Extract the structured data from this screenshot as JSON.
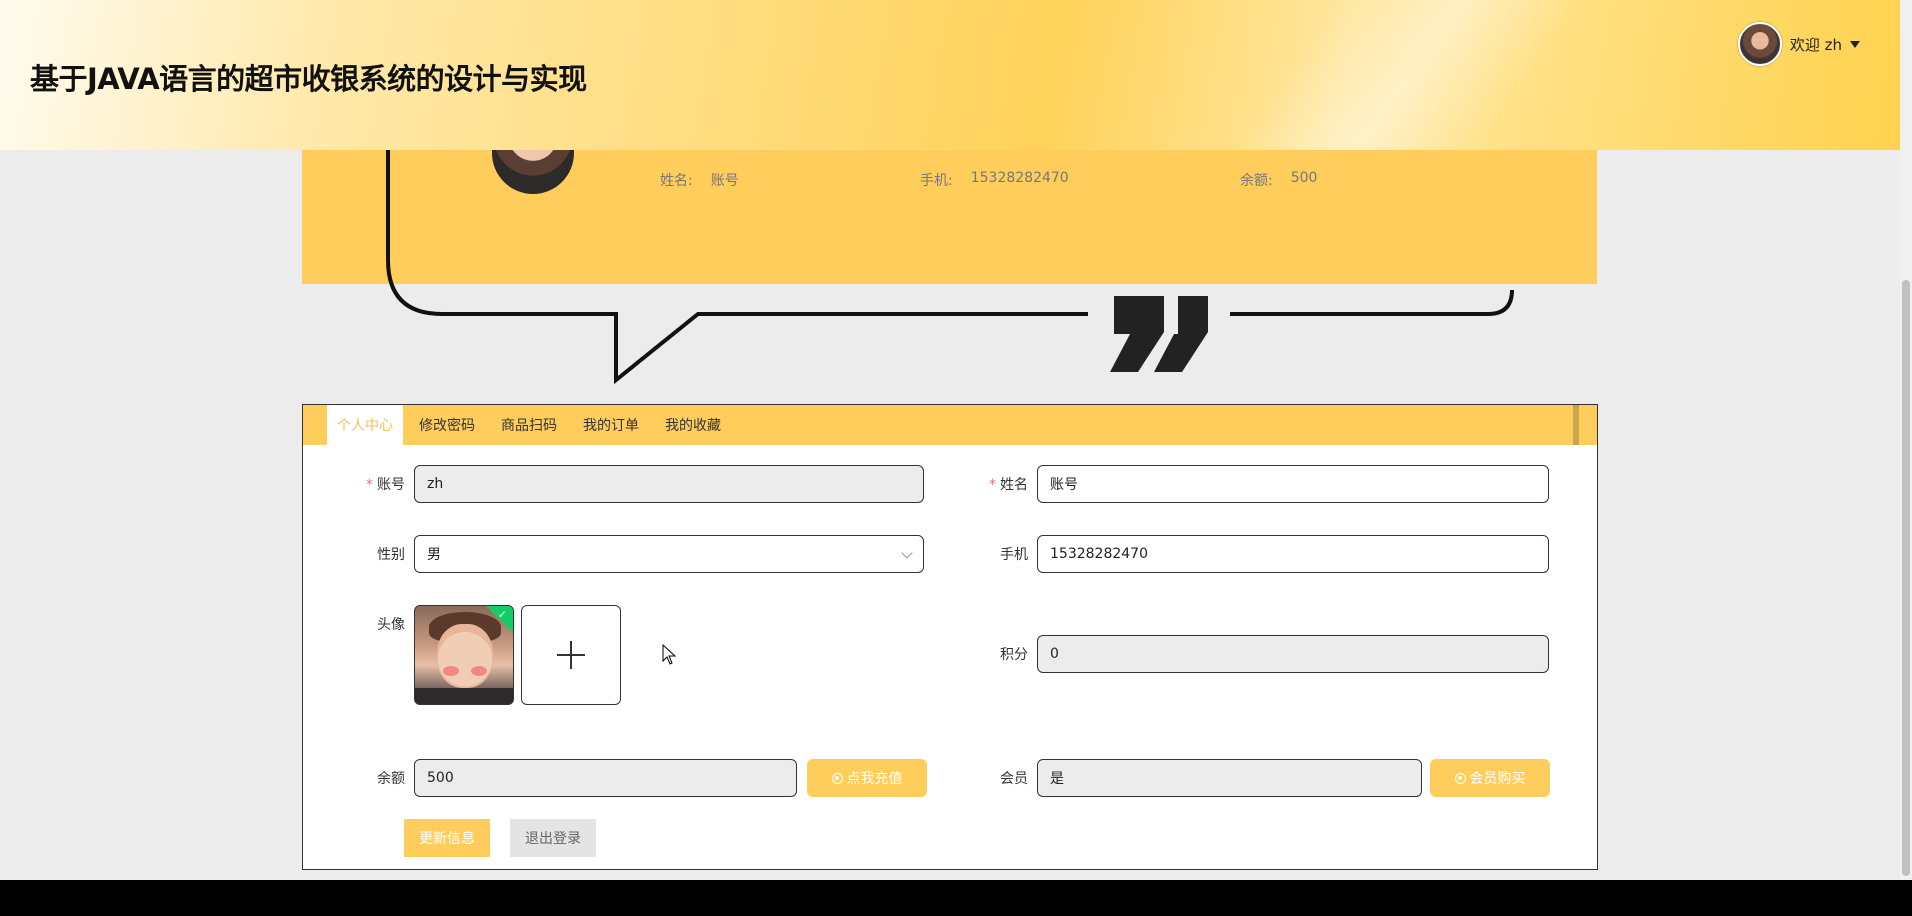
{
  "header": {
    "title": "基于JAVA语言的超市收银系统的设计与实现",
    "welcome": "欢迎 zh"
  },
  "banner": {
    "name_label": "姓名:",
    "name_value": "账号",
    "phone_label": "手机:",
    "phone_value": "15328282470",
    "balance_label": "余额:",
    "balance_value": "500"
  },
  "tabs": [
    {
      "label": "个人中心",
      "active": true
    },
    {
      "label": "修改密码",
      "active": false
    },
    {
      "label": "商品扫码",
      "active": false
    },
    {
      "label": "我的订单",
      "active": false
    },
    {
      "label": "我的收藏",
      "active": false
    }
  ],
  "form": {
    "account_label": "账号",
    "account_value": "zh",
    "name_label": "姓名",
    "name_value": "账号",
    "gender_label": "性别",
    "gender_value": "男",
    "phone_label": "手机",
    "phone_value": "15328282470",
    "avatar_label": "头像",
    "points_label": "积分",
    "points_value": "0",
    "balance_label": "余额",
    "balance_value": "500",
    "recharge_label": "点我充值",
    "member_label": "会员",
    "member_value": "是",
    "member_buy_label": "会员购买",
    "update_label": "更新信息",
    "logout_label": "退出登录"
  },
  "colors": {
    "accent": "#ffcd5c",
    "required": "#f56c6c",
    "success": "#13ce66"
  }
}
